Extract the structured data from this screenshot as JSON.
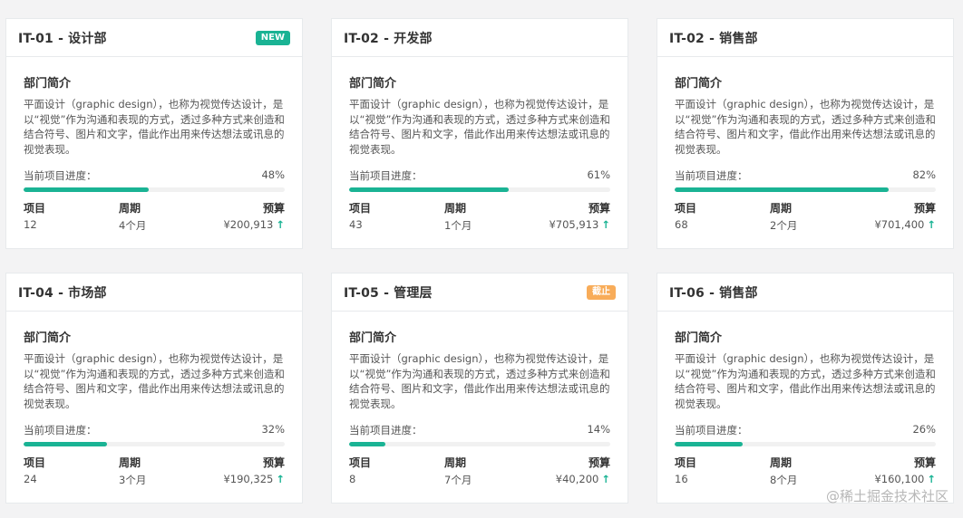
{
  "colors": {
    "accent": "#1ab394",
    "new_badge": "#1ab394",
    "stop_badge": "#f8ac59"
  },
  "cards": [
    {
      "title": "IT-01 - 设计部",
      "badge": "NEW",
      "badge_color": "#1ab394",
      "section_title": "部门简介",
      "description": "平面设计（graphic design），也称为视觉传达设计，是以“视觉”作为沟通和表现的方式，透过多种方式来创造和结合符号、图片和文字，借此作出用来传达想法或讯息的视觉表现。",
      "progress_label": "当前项目进度：",
      "progress": "48%",
      "progress_value": 48,
      "project_label": "项目",
      "project_value": "12",
      "period_label": "周期",
      "period_value": "4个月",
      "budget_label": "预算",
      "budget_value": "¥200,913",
      "trend_icon": "arrow-up-icon"
    },
    {
      "title": "IT-02 - 开发部",
      "badge": "",
      "badge_color": "",
      "section_title": "部门简介",
      "description": "平面设计（graphic design），也称为视觉传达设计，是以“视觉”作为沟通和表现的方式，透过多种方式来创造和结合符号、图片和文字，借此作出用来传达想法或讯息的视觉表现。",
      "progress_label": "当前项目进度：",
      "progress": "61%",
      "progress_value": 61,
      "project_label": "项目",
      "project_value": "43",
      "period_label": "周期",
      "period_value": "1个月",
      "budget_label": "预算",
      "budget_value": "¥705,913",
      "trend_icon": "arrow-up-icon"
    },
    {
      "title": "IT-02 - 销售部",
      "badge": "",
      "badge_color": "",
      "section_title": "部门简介",
      "description": "平面设计（graphic design），也称为视觉传达设计，是以“视觉”作为沟通和表现的方式，透过多种方式来创造和结合符号、图片和文字，借此作出用来传达想法或讯息的视觉表现。",
      "progress_label": "当前项目进度：",
      "progress": "82%",
      "progress_value": 82,
      "project_label": "项目",
      "project_value": "68",
      "period_label": "周期",
      "period_value": "2个月",
      "budget_label": "预算",
      "budget_value": "¥701,400",
      "trend_icon": "arrow-up-icon"
    },
    {
      "title": "IT-04 - 市场部",
      "badge": "",
      "badge_color": "",
      "section_title": "部门简介",
      "description": "平面设计（graphic design），也称为视觉传达设计，是以“视觉”作为沟通和表现的方式，透过多种方式来创造和结合符号、图片和文字，借此作出用来传达想法或讯息的视觉表现。",
      "progress_label": "当前项目进度：",
      "progress": "32%",
      "progress_value": 32,
      "project_label": "项目",
      "project_value": "24",
      "period_label": "周期",
      "period_value": "3个月",
      "budget_label": "预算",
      "budget_value": "¥190,325",
      "trend_icon": "arrow-up-icon"
    },
    {
      "title": "IT-05 - 管理层",
      "badge": "截止",
      "badge_color": "#f8ac59",
      "section_title": "部门简介",
      "description": "平面设计（graphic design），也称为视觉传达设计，是以“视觉”作为沟通和表现的方式，透过多种方式来创造和结合符号、图片和文字，借此作出用来传达想法或讯息的视觉表现。",
      "progress_label": "当前项目进度：",
      "progress": "14%",
      "progress_value": 14,
      "project_label": "项目",
      "project_value": "8",
      "period_label": "周期",
      "period_value": "7个月",
      "budget_label": "预算",
      "budget_value": "¥40,200",
      "trend_icon": "arrow-up-icon"
    },
    {
      "title": "IT-06 - 销售部",
      "badge": "",
      "badge_color": "",
      "section_title": "部门简介",
      "description": "平面设计（graphic design），也称为视觉传达设计，是以“视觉”作为沟通和表现的方式，透过多种方式来创造和结合符号、图片和文字，借此作出用来传达想法或讯息的视觉表现。",
      "progress_label": "当前项目进度：",
      "progress": "26%",
      "progress_value": 26,
      "project_label": "项目",
      "project_value": "16",
      "period_label": "周期",
      "period_value": "8个月",
      "budget_label": "预算",
      "budget_value": "¥160,100",
      "trend_icon": "arrow-up-icon"
    }
  ],
  "watermark": "@稀土掘金技术社区"
}
